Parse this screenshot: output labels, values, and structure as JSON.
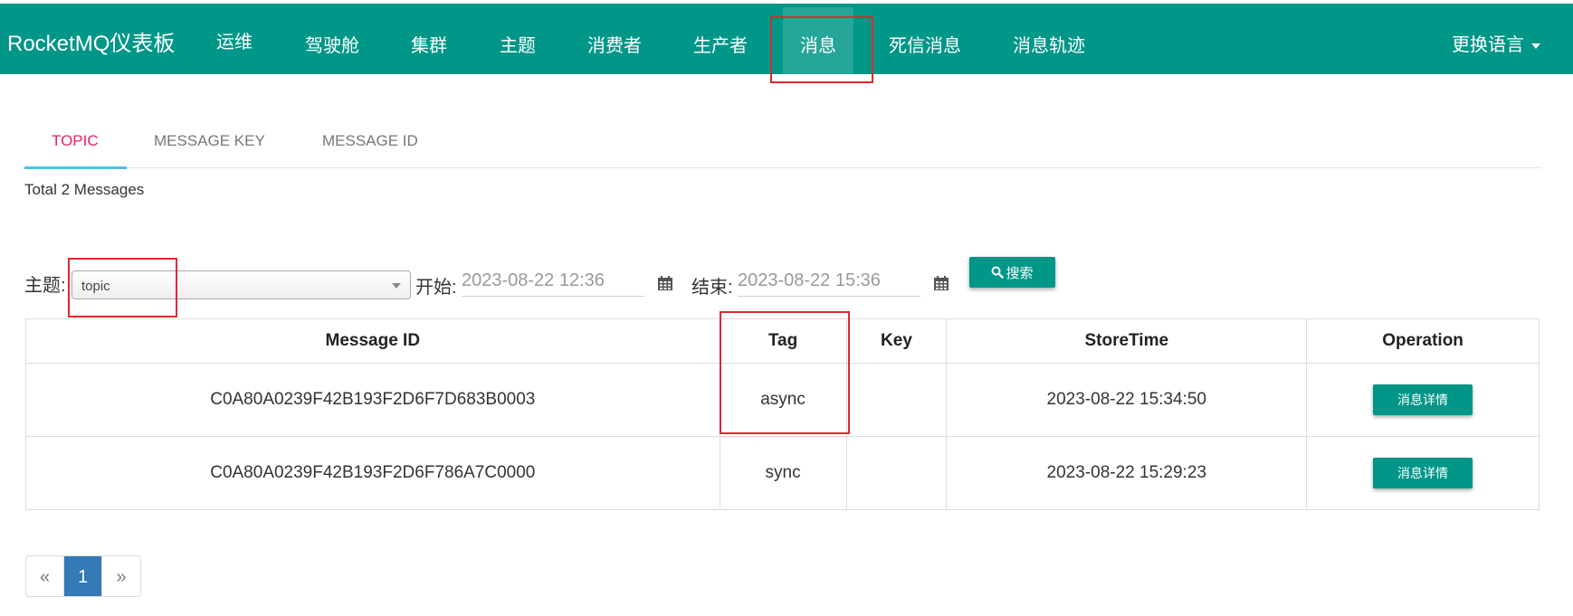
{
  "navbar": {
    "brand": "RocketMQ仪表板",
    "items": [
      "运维",
      "驾驶舱",
      "集群",
      "主题",
      "消费者",
      "生产者",
      "消息",
      "死信消息",
      "消息轨迹"
    ],
    "active_index": 6,
    "language": "更换语言"
  },
  "tabs": {
    "items": [
      "TOPIC",
      "MESSAGE KEY",
      "MESSAGE ID"
    ],
    "active": "TOPIC"
  },
  "summary": {
    "total": "Total 2 Messages"
  },
  "search": {
    "topic_label": "主题:",
    "topic_value": "topic",
    "start_label": "开始:",
    "start_value": "2023-08-22 12:36",
    "end_label": "结束:",
    "end_value": "2023-08-22 15:36",
    "search_button": "搜索",
    "icons": {
      "search": "search-icon",
      "calendar": "calendar-icon"
    }
  },
  "table": {
    "headers": [
      "Message ID",
      "Tag",
      "Key",
      "StoreTime",
      "Operation"
    ],
    "rows": [
      {
        "message_id": "C0A80A0239F42B193F2D6F7D683B0003",
        "tag": "async",
        "key": "",
        "store_time": "2023-08-22 15:34:50",
        "operation": "消息详情"
      },
      {
        "message_id": "C0A80A0239F42B193F2D6F786A7C0000",
        "tag": "sync",
        "key": "",
        "store_time": "2023-08-22 15:29:23",
        "operation": "消息详情"
      }
    ]
  },
  "pagination": {
    "prev": "«",
    "current": "1",
    "next": "»"
  },
  "colors": {
    "primary": "#009688",
    "tab_active": "#e91e63",
    "tab_ink": "#4dc0e8",
    "page_active": "#337ab7",
    "highlight": "#e0282e"
  }
}
